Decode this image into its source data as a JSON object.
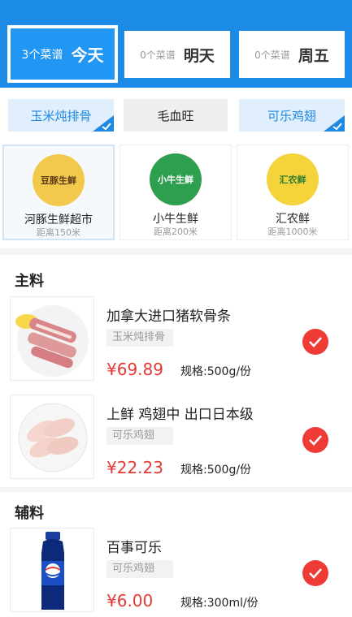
{
  "days": [
    {
      "count": "3个菜谱",
      "name": "今天",
      "selected": true
    },
    {
      "count": "0个菜谱",
      "name": "明天",
      "selected": false
    },
    {
      "count": "0个菜谱",
      "name": "周五",
      "selected": false
    }
  ],
  "dishes": [
    {
      "label": "玉米炖排骨",
      "selected": true
    },
    {
      "label": "毛血旺",
      "selected": false
    },
    {
      "label": "可乐鸡翅",
      "selected": true
    }
  ],
  "stores": [
    {
      "name": "河豚生鲜超市",
      "distance": "距离150米",
      "logo_text": "豆豚生鲜",
      "logo_color": "#f2c94c",
      "selected": true
    },
    {
      "name": "小牛生鲜",
      "distance": "距离200米",
      "logo_text": "小牛生鲜",
      "logo_color": "#2e9e4f",
      "selected": false
    },
    {
      "name": "汇农鲜",
      "distance": "距离1000米",
      "logo_text": "汇农鲜",
      "logo_color": "#f5d33a",
      "selected": false
    }
  ],
  "sections": {
    "main": "主料",
    "aux": "辅料"
  },
  "items": [
    {
      "title": "加拿大进口猪软骨条",
      "tag": "玉米炖排骨",
      "price": "¥69.89",
      "spec": "规格:500g/份",
      "checked": true
    },
    {
      "title": "上鲜 鸡翅中 出口日本级",
      "tag": "可乐鸡翅",
      "price": "¥22.23",
      "spec": "规格:500g/份",
      "checked": true
    },
    {
      "title": "百事可乐",
      "tag": "可乐鸡翅",
      "price": "¥6.00",
      "spec": "规格:300ml/份",
      "checked": true
    }
  ],
  "colors": {
    "header": "#1c8be6",
    "accent": "#1e88e5",
    "price": "#e53935",
    "check": "#ef3b36"
  }
}
